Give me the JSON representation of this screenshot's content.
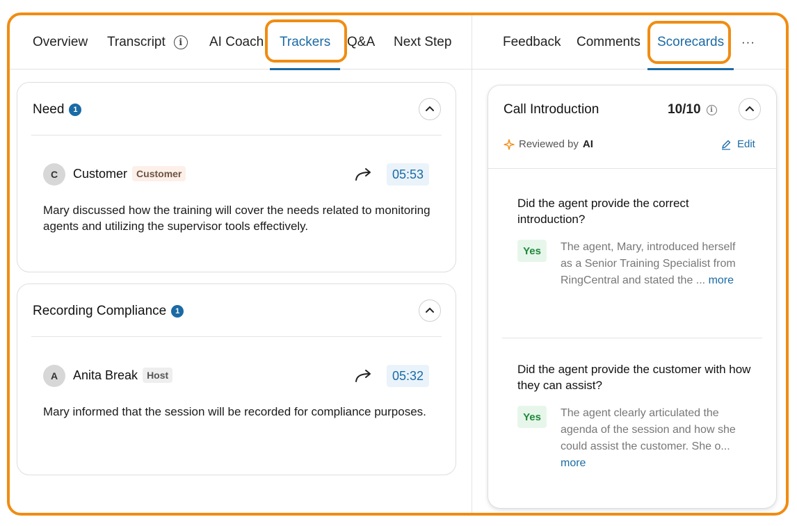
{
  "tabs_left": [
    {
      "label": "Overview"
    },
    {
      "label": "Transcript"
    },
    {
      "label": "AI Coach"
    },
    {
      "label": "Trackers",
      "active": true
    },
    {
      "label": "Q&A"
    },
    {
      "label": "Next Step"
    }
  ],
  "tabs_right": [
    {
      "label": "Feedback"
    },
    {
      "label": "Comments"
    },
    {
      "label": "Scorecards",
      "active": true
    },
    {
      "label": "···"
    }
  ],
  "trackers": [
    {
      "title": "Need",
      "count": "1",
      "speaker_initial": "C",
      "speaker": "Customer",
      "role": "Customer",
      "time": "05:53",
      "text": "Mary discussed how the training will cover the needs related to monitoring agents and utilizing the supervisor tools effectively."
    },
    {
      "title": "Recording Compliance",
      "count": "1",
      "speaker_initial": "A",
      "speaker": "Anita Break",
      "role": "Host",
      "time": "05:32",
      "text": "Mary informed that the session will be recorded for compliance purposes."
    }
  ],
  "scorecard": {
    "title": "Call Introduction",
    "score": "10/10",
    "reviewed_by_label": "Reviewed by",
    "reviewed_by": "AI",
    "edit_label": "Edit",
    "questions": [
      {
        "question": "Did the agent provide the correct introduction?",
        "answer_badge": "Yes",
        "answer": "The agent, Mary, introduced herself as a Senior Training Specialist from RingCentral and stated the ...",
        "more": "more"
      },
      {
        "question": "Did the agent provide the customer with how they can assist?",
        "answer_badge": "Yes",
        "answer": "The agent clearly articulated the agenda of the session and how she could assist the customer. She o...",
        "more": "more"
      }
    ]
  },
  "colors": {
    "accent": "#1a6aa5",
    "highlight": "#f08c12",
    "yes_green": "#1f8a3c"
  }
}
